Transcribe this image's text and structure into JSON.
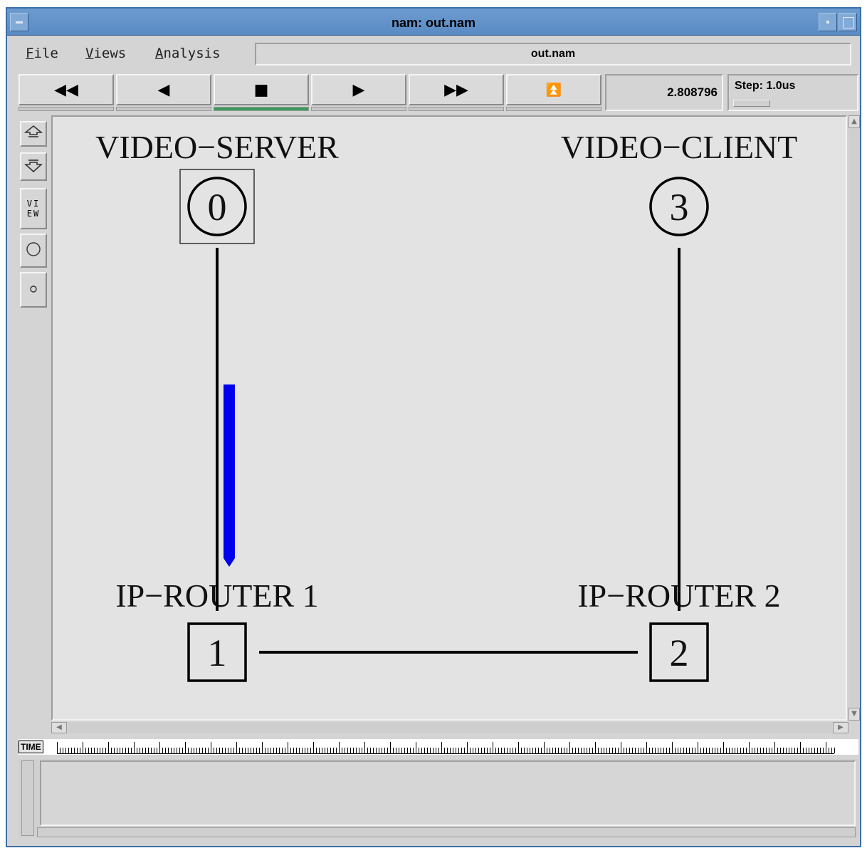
{
  "window": {
    "title": "nam: out.nam"
  },
  "menu": {
    "file": "File",
    "views": "Views",
    "analysis": "Analysis"
  },
  "file_field": "out.nam",
  "toolbar": {
    "buttons": [
      {
        "name": "rewind-button",
        "glyph": "◀◀"
      },
      {
        "name": "step-back-button",
        "glyph": "◀"
      },
      {
        "name": "stop-button",
        "glyph": "■"
      },
      {
        "name": "play-button",
        "glyph": "▶"
      },
      {
        "name": "fast-forward-button",
        "glyph": "▶▶"
      },
      {
        "name": "eject-button",
        "glyph": "⏫"
      }
    ],
    "active_index": 2,
    "time": "2.808796",
    "step": "Step: 1.0us"
  },
  "palette": {
    "zoom_in_icon": "zoom-in-icon",
    "zoom_out_icon": "zoom-out-icon",
    "view_label_1": "VI",
    "view_label_2": "EW",
    "circle_large_icon": "circle-large-icon",
    "circle_small_icon": "circle-small-icon"
  },
  "topology": {
    "nodes": [
      {
        "id": "0",
        "label": "VIDEO−SERVER",
        "shape": "circle",
        "selected": true
      },
      {
        "id": "1",
        "label": "IP−ROUTER 1",
        "shape": "square"
      },
      {
        "id": "2",
        "label": "IP−ROUTER 2",
        "shape": "square"
      },
      {
        "id": "3",
        "label": "VIDEO−CLIENT",
        "shape": "circle"
      }
    ],
    "links": [
      [
        "0",
        "1"
      ],
      [
        "1",
        "2"
      ],
      [
        "2",
        "3"
      ]
    ],
    "packet_color": "#0000ee"
  },
  "timeline": {
    "tag": "TIME"
  }
}
